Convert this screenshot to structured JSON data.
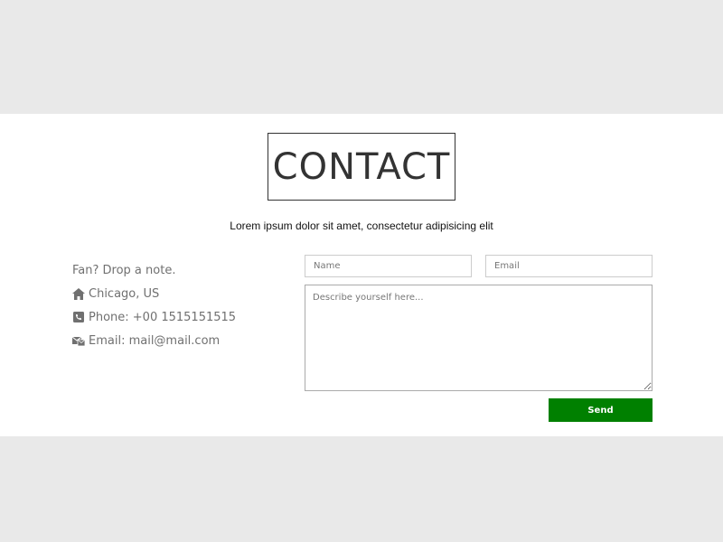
{
  "contact": {
    "title": "CONTACT",
    "subtitle": "Lorem ipsum dolor sit amet, consectetur adipisicing elit"
  },
  "info": {
    "heading": "Fan? Drop a note.",
    "location": {
      "icon": "home-icon",
      "text": "Chicago, US"
    },
    "phone": {
      "icon": "phone-icon",
      "text": "Phone: +00 1515151515"
    },
    "email": {
      "icon": "envelope-icon",
      "text": "Email: mail@mail.com"
    }
  },
  "form": {
    "name_placeholder": "Name",
    "email_placeholder": "Email",
    "message_placeholder": "Describe yourself here...",
    "send_label": "Send"
  },
  "colors": {
    "background": "#e9e9e9",
    "band": "#ffffff",
    "accent_green": "#008000",
    "text_gray": "#707070"
  }
}
